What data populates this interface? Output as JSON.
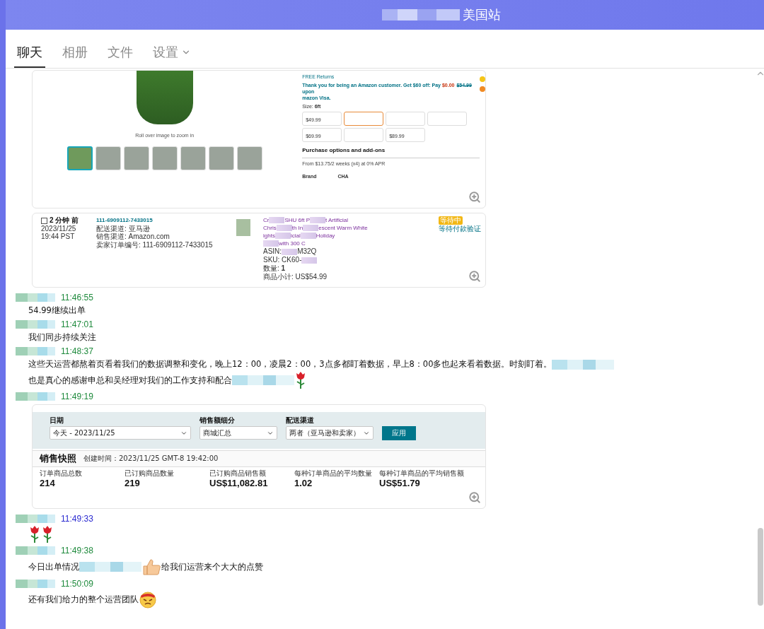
{
  "window": {
    "title": "美国站"
  },
  "tabs": [
    {
      "label": "聊天",
      "selected": true,
      "dropdown": false
    },
    {
      "label": "相册",
      "selected": false,
      "dropdown": false
    },
    {
      "label": "文件",
      "selected": false,
      "dropdown": false
    },
    {
      "label": "设置",
      "selected": false,
      "dropdown": true
    }
  ],
  "messages": [
    {
      "content": [
        {
          "kind": "product_screenshot",
          "caption": "Roll over image to zoom in",
          "returns": "FREE Returns",
          "offer": [
            {
              "kind": "plain",
              "text": "Thank you for being an Amazon customer. Get $60 off: Pay "
            },
            {
              "kind": "price",
              "text": "$0.00"
            },
            {
              "kind": "strike",
              "text": "$54.99"
            },
            {
              "kind": "plain",
              "text": " upon"
            }
          ],
          "offer_line2": "mazon Visa.",
          "size_label": "Size: ",
          "size_value": "6ft",
          "options": [
            {
              "price": "$49.99",
              "selected": false
            },
            {
              "selected": true
            },
            {
              "selected": false
            },
            {
              "selected": false
            },
            {
              "price": "$69.99",
              "selected": false
            },
            {
              "selected": false
            },
            {
              "price": "$89.99",
              "selected": false
            }
          ],
          "section": "Purchase options and add-ons",
          "payment": "From $13.75/2 weeks (x4) at 0% APR",
          "brand_label": "Brand",
          "brand_value": "CHA"
        }
      ]
    },
    {
      "content": [
        {
          "kind": "order_screenshot",
          "age": "2 分钟 前",
          "date": "2023/11/25",
          "clock": "19:44 PST",
          "order_id": "111-6909112-7433015",
          "details": [
            "配送渠道: 亚马逊",
            "销售渠道: Amazon.com",
            "卖家订单编号: 111-6909112-7433015"
          ],
          "title_lines": [
            [
              {
                "kind": "text",
                "text": "Cr"
              },
              {
                "kind": "blur"
              },
              {
                "kind": "text",
                "text": "SHU 6ft P"
              },
              {
                "kind": "blur"
              },
              {
                "kind": "text",
                "text": "t Artificial"
              }
            ],
            [
              {
                "kind": "text",
                "text": "Chris"
              },
              {
                "kind": "blur"
              },
              {
                "kind": "text",
                "text": "th In"
              },
              {
                "kind": "blur"
              },
              {
                "kind": "text",
                "text": "escent Warm White"
              }
            ],
            [
              {
                "kind": "text",
                "text": "ights"
              },
              {
                "kind": "blur"
              },
              {
                "kind": "text",
                "text": "icial"
              },
              {
                "kind": "blur"
              },
              {
                "kind": "text",
                "text": "Holiday"
              }
            ],
            [
              {
                "kind": "blur"
              },
              {
                "kind": "text",
                "text": "with 300 C"
              }
            ]
          ],
          "meta_lines": [
            [
              {
                "kind": "text",
                "text": "ASIN:"
              },
              {
                "kind": "blur"
              },
              {
                "kind": "text",
                "text": "M32Q"
              }
            ],
            [
              {
                "kind": "text",
                "text": "SKU: CK60-"
              },
              {
                "kind": "blur"
              }
            ],
            [
              {
                "kind": "text",
                "text": "数量: **1**"
              }
            ],
            [
              {
                "kind": "text",
                "text": "商品小计: US$54.99"
              }
            ]
          ],
          "badge": "等待中",
          "status": "等待付款验证"
        }
      ]
    },
    {
      "time": "11:46:55",
      "color": "#1e8a3c",
      "content": [
        {
          "kind": "text",
          "text": "54.99继续出单"
        }
      ]
    },
    {
      "time": "11:47:01",
      "color": "#1e8a3c",
      "content": [
        {
          "kind": "text",
          "text": "我们同步持续关注"
        }
      ]
    },
    {
      "time": "11:48:37",
      "color": "#1e8a3c",
      "content": [
        {
          "kind": "text",
          "text": "这些天运营都熬着页看着我们的数据调整和变化，晚上12：00，凌晨2：00，3点多都盯着数据，早上8：00多也起来看着数据。时刻盯着。"
        },
        {
          "kind": "blur"
        },
        {
          "kind": "text",
          "text": "也是真心的感谢申总和吴经理对我们的工"
        },
        {
          "kind": "text",
          "text": "作支持和配合"
        },
        {
          "kind": "blur"
        },
        {
          "kind": "rose"
        }
      ]
    },
    {
      "time": "11:49:19",
      "color": "#1e8a3c",
      "content": [
        {
          "kind": "sales_screenshot",
          "filters": [
            {
              "label": "日期",
              "value": "今天 - 2023/11/25"
            },
            {
              "label": "销售额细分",
              "value": "商城汇总"
            },
            {
              "label": "配送渠道",
              "value": "两者（亚马逊和卖家）"
            }
          ],
          "apply": "应用",
          "title": "销售快照",
          "created": "创建时间：2023/11/25 GMT-8 19:42:00",
          "metrics": [
            {
              "label": "订单商品总数",
              "value": "214"
            },
            {
              "label": "已订购商品数量",
              "value": "219"
            },
            {
              "label": "已订购商品销售额",
              "value": "US$11,082.81"
            },
            {
              "label": "每种订单商品的平均数量",
              "value": "1.02"
            },
            {
              "label": "每种订单商品的平均销售额",
              "value": "US$51.79"
            }
          ]
        }
      ]
    },
    {
      "time": "11:49:33",
      "color": "#2a2ad0",
      "content": [
        {
          "kind": "rose"
        },
        {
          "kind": "rose"
        }
      ]
    },
    {
      "time": "11:49:38",
      "color": "#1e8a3c",
      "content": [
        {
          "kind": "text",
          "text": "今日出单情况"
        },
        {
          "kind": "blur"
        },
        {
          "kind": "thumbs_up"
        },
        {
          "kind": "text",
          "text": "给我们运营来个大大的点赞"
        }
      ]
    },
    {
      "time": "11:50:09",
      "color": "#1e8a3c",
      "content": [
        {
          "kind": "text",
          "text": "还有我们给力的整个运营团队"
        },
        {
          "kind": "angry_face"
        }
      ]
    }
  ]
}
